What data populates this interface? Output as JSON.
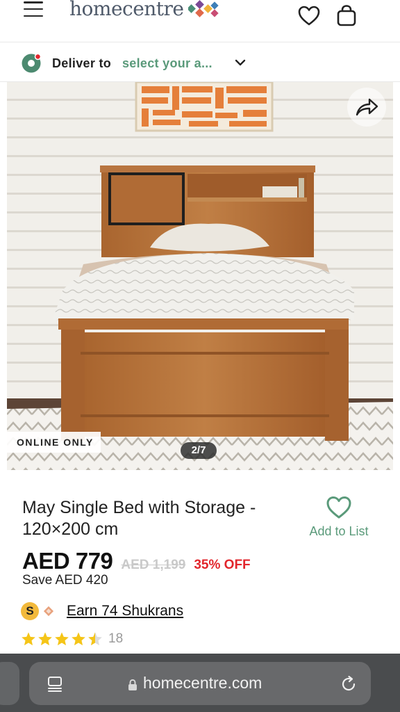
{
  "header": {
    "logo_text": "homecentre",
    "menu_icon": "hamburger-menu-icon",
    "wishlist_icon": "heart-icon",
    "cart_icon": "shopping-bag-icon"
  },
  "delivery": {
    "label": "Deliver to",
    "value": "select your a...",
    "pin_icon": "location-pin-icon",
    "chevron_icon": "chevron-down-icon"
  },
  "gallery": {
    "badge": "ONLINE ONLY",
    "counter": "2/7",
    "share_icon": "share-arrow-icon"
  },
  "product": {
    "title": "May Single Bed with Storage - 120×200 cm",
    "wishlist_label": "Add to List",
    "price": "AED 779",
    "old_price": "AED 1,199",
    "discount": "35% OFF",
    "savings": "Save AED 420",
    "shukran_coin": "S",
    "shukran_text": "Earn 74 Shukrans",
    "rating": 4.5,
    "rating_count": "18"
  },
  "browser": {
    "url": "homecentre.com",
    "reload_icon": "reload-icon",
    "tabs_icon": "tabs-overview-icon",
    "lock_icon": "lock-icon"
  },
  "colors": {
    "accent_green": "#5a9a7a",
    "discount_red": "#e2262c",
    "star_yellow": "#f5c518",
    "shukran_gold": "#f2b93b"
  }
}
